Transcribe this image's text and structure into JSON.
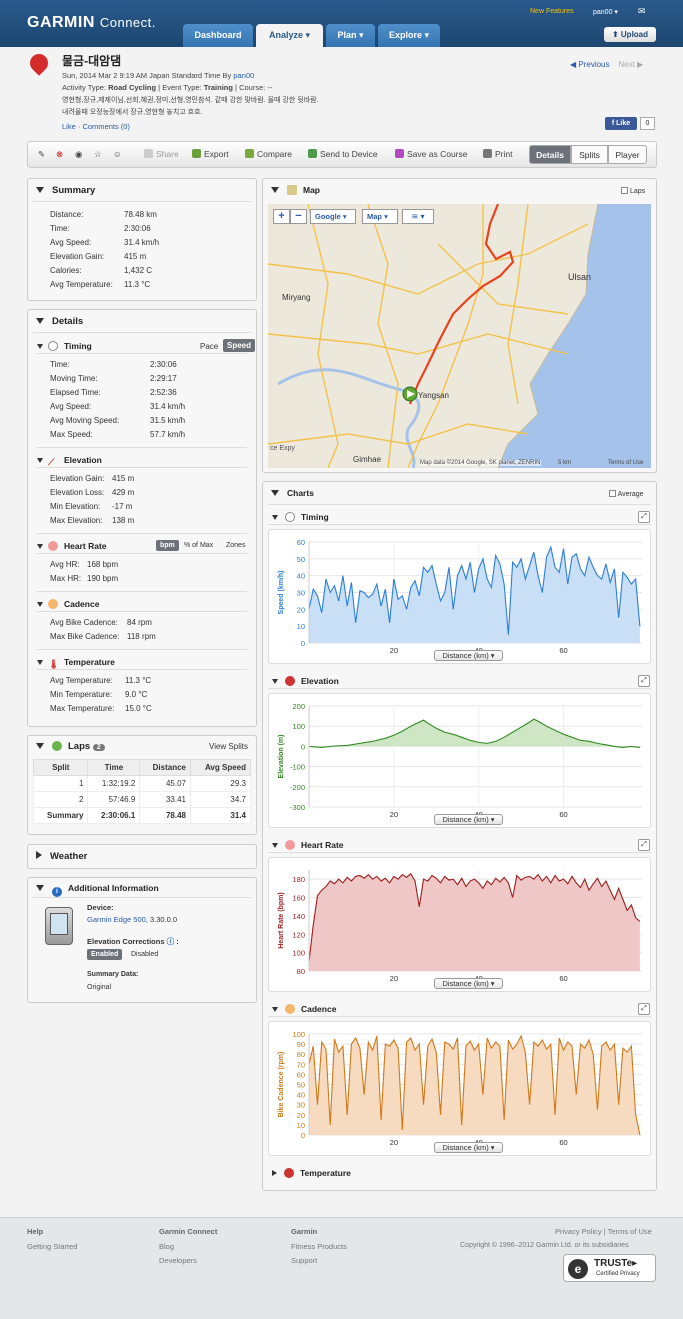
{
  "nav": {
    "logo": "GARMIN",
    "logo_sub": "Connect.",
    "tabs": [
      "Dashboard",
      "Analyze",
      "Plan",
      "Explore"
    ],
    "new_features": "New Features",
    "user": "pan00",
    "upload": "Upload"
  },
  "activity": {
    "name": "물금-대암댐",
    "date_line": "Sun, 2014 Mar 2 9:19 AM Japan Standard Time By",
    "author": "pan00",
    "type_label": "Activity Type:",
    "type": "Road Cycling",
    "event_label": "| Event Type:",
    "event": "Training",
    "course": "| Course: --",
    "desc1": "영현형,장규,제제이님,선회,혜권,정미,선형,영민참석. 같때 강한 맞바람. 올때 강한 뒷바람.",
    "desc2": "내려올때 오정능장에서 장규,영현형 놓치고 흐흐.",
    "like": "Like",
    "comments": "Comments (0)",
    "prev": "Previous",
    "next": "Next",
    "fb_like": "Like",
    "fb_count": "0"
  },
  "toolbar": {
    "share": "Share",
    "export": "Export",
    "compare": "Compare",
    "send": "Send to Device",
    "save": "Save as Course",
    "print": "Print",
    "views": [
      "Details",
      "Splits",
      "Player"
    ]
  },
  "summary": {
    "title": "Summary",
    "rows": [
      [
        "Distance:",
        "78.48 km"
      ],
      [
        "Time:",
        "2:30:06"
      ],
      [
        "Avg Speed:",
        "31.4 km/h"
      ],
      [
        "Elevation Gain:",
        "415 m"
      ],
      [
        "Calories:",
        "1,432 C"
      ],
      [
        "Avg Temperature:",
        "11.3 °C"
      ]
    ]
  },
  "details": {
    "title": "Details",
    "timing": {
      "title": "Timing",
      "pace": "Pace",
      "speed": "Speed",
      "rows": [
        [
          "Time:",
          "2:30:06"
        ],
        [
          "Moving Time:",
          "2:29:17"
        ],
        [
          "Elapsed Time:",
          "2:52:36"
        ],
        [
          "Avg Speed:",
          "31.4 km/h"
        ],
        [
          "Avg Moving Speed:",
          "31.5 km/h"
        ],
        [
          "Max Speed:",
          "57.7 km/h"
        ]
      ]
    },
    "elevation": {
      "title": "Elevation",
      "rows": [
        [
          "Elevation Gain:",
          "415 m"
        ],
        [
          "Elevation Loss:",
          "429 m"
        ],
        [
          "Min Elevation:",
          "-17 m"
        ],
        [
          "Max Elevation:",
          "138 m"
        ]
      ]
    },
    "heart": {
      "title": "Heart Rate",
      "bpm": "bpm",
      "pctmax": "% of Max",
      "zones": "Zones",
      "rows": [
        [
          "Avg HR:",
          "168 bpm"
        ],
        [
          "Max HR:",
          "190 bpm"
        ]
      ]
    },
    "cadence": {
      "title": "Cadence",
      "rows": [
        [
          "Avg Bike Cadence:",
          "84 rpm"
        ],
        [
          "Max Bike Cadence:",
          "118 rpm"
        ]
      ]
    },
    "temperature": {
      "title": "Temperature",
      "rows": [
        [
          "Avg Temperature:",
          "11.3 °C"
        ],
        [
          "Min Temperature:",
          "9.0 °C"
        ],
        [
          "Max Temperature:",
          "15.0 °C"
        ]
      ]
    }
  },
  "laps": {
    "title": "Laps",
    "count": "2",
    "view_splits": "View Splits",
    "headers": [
      "Split",
      "Time",
      "Distance",
      "Avg Speed"
    ],
    "rows": [
      [
        "1",
        "1:32:19.2",
        "45.07",
        "29.3"
      ],
      [
        "2",
        "57:46.9",
        "33.41",
        "34.7"
      ],
      [
        "Summary",
        "2:30:06.1",
        "78.48",
        "31.4"
      ]
    ]
  },
  "weather": {
    "title": "Weather"
  },
  "additional": {
    "title": "Additional Information",
    "device_label": "Device:",
    "device": "Garmin Edge 500",
    "device_ver": ", 3.30.0.0",
    "elev_corr": "Elevation Corrections",
    "enabled": "Enabled",
    "disabled": "Disabled",
    "summary_label": "Summary Data:",
    "summary_value": "Original"
  },
  "map": {
    "title": "Map",
    "laps": "Laps",
    "google": "Google",
    "mapbtn": "Map",
    "attribution": "Map data ©2014 Google, SK planet, ZENRIN",
    "scale": "5 km",
    "terms": "Terms of Use",
    "labels": [
      "Ulsan",
      "Miryang",
      "Yangsan",
      "Gimhae",
      "ce Expy"
    ],
    "route_color": "#e8431e"
  },
  "charts": {
    "title": "Charts",
    "average": "Average",
    "xlabel": "Distance (km)"
  },
  "chart_data": [
    {
      "type": "area",
      "title": "Timing",
      "ylabel": "Speed (km/h)",
      "ylim": [
        0,
        60
      ],
      "yticks": [
        0,
        10,
        20,
        30,
        40,
        50,
        60
      ],
      "xticks": [
        20,
        40,
        60
      ],
      "xlim": [
        0,
        78.5
      ],
      "color": "#2a7ed8",
      "fill": "#c9dff5",
      "x": [
        0,
        1,
        2,
        3,
        4,
        5,
        6,
        7,
        8,
        9,
        10,
        11,
        12,
        13,
        14,
        15,
        16,
        17,
        18,
        19,
        20,
        21,
        22,
        23,
        24,
        25,
        26,
        27,
        28,
        29,
        30,
        31,
        32,
        33,
        34,
        35,
        36,
        37,
        38,
        39,
        40,
        41,
        42,
        43,
        44,
        45,
        46,
        47,
        48,
        49,
        50,
        51,
        52,
        53,
        54,
        55,
        56,
        57,
        58,
        59,
        60,
        61,
        62,
        63,
        64,
        65,
        66,
        67,
        68,
        69,
        70,
        71,
        72,
        73,
        74,
        75,
        76,
        77,
        78
      ],
      "y": [
        20,
        32,
        28,
        18,
        38,
        30,
        34,
        25,
        40,
        22,
        36,
        12,
        31,
        30,
        27,
        29,
        35,
        22,
        32,
        12,
        38,
        26,
        28,
        20,
        33,
        37,
        28,
        45,
        42,
        46,
        35,
        25,
        30,
        45,
        20,
        40,
        46,
        38,
        48,
        30,
        44,
        50,
        38,
        33,
        52,
        47,
        35,
        5,
        48,
        45,
        50,
        38,
        46,
        54,
        40,
        30,
        51,
        57,
        45,
        42,
        56,
        35,
        51,
        53,
        44,
        40,
        51,
        45,
        40,
        38,
        47,
        36,
        44,
        15,
        42,
        39,
        35,
        38,
        10
      ]
    },
    {
      "type": "area",
      "title": "Elevation",
      "ylabel": "Elevation (m)",
      "ylim": [
        -300,
        200
      ],
      "yticks": [
        -300,
        -200,
        -100,
        0,
        100,
        200
      ],
      "xticks": [
        20,
        40,
        60
      ],
      "xlim": [
        0,
        78.5
      ],
      "color": "#2f8a1f",
      "fill": "#cfe6c5",
      "x": [
        0,
        3,
        6,
        9,
        12,
        15,
        18,
        20,
        22,
        24,
        26,
        27,
        28,
        30,
        32,
        34,
        36,
        38,
        40,
        42,
        44,
        46,
        48,
        50,
        52,
        53,
        54,
        56,
        58,
        60,
        62,
        64,
        66,
        68,
        70,
        72,
        74,
        76,
        78
      ],
      "y": [
        0,
        -5,
        2,
        5,
        15,
        25,
        40,
        55,
        75,
        100,
        120,
        130,
        115,
        90,
        70,
        60,
        45,
        30,
        20,
        15,
        25,
        45,
        70,
        95,
        120,
        135,
        125,
        100,
        80,
        60,
        45,
        30,
        25,
        15,
        8,
        0,
        -5,
        0,
        -5
      ]
    },
    {
      "type": "area",
      "title": "Heart Rate",
      "ylabel": "Heart Rate (bpm)",
      "ylim": [
        80,
        190
      ],
      "yticks": [
        80,
        100,
        120,
        140,
        160,
        180
      ],
      "xticks": [
        20,
        40,
        60
      ],
      "xlim": [
        0,
        78.5
      ],
      "color": "#9e1c1c",
      "fill": "#efc7c7",
      "x": [
        0,
        1,
        2,
        3,
        4,
        5,
        6,
        7,
        8,
        9,
        10,
        11,
        12,
        13,
        14,
        15,
        16,
        17,
        18,
        19,
        20,
        21,
        22,
        23,
        24,
        25,
        26,
        27,
        28,
        29,
        30,
        31,
        32,
        33,
        34,
        35,
        36,
        37,
        38,
        39,
        40,
        41,
        42,
        43,
        44,
        45,
        46,
        47,
        48,
        49,
        50,
        51,
        52,
        53,
        54,
        55,
        56,
        57,
        58,
        59,
        60,
        61,
        62,
        63,
        64,
        65,
        66,
        67,
        68,
        69,
        70,
        71,
        72,
        73,
        74,
        75,
        76,
        77,
        78
      ],
      "y": [
        90,
        130,
        162,
        168,
        172,
        178,
        175,
        180,
        176,
        182,
        178,
        183,
        184,
        181,
        185,
        180,
        183,
        178,
        181,
        176,
        183,
        180,
        185,
        182,
        186,
        178,
        150,
        180,
        178,
        184,
        181,
        176,
        183,
        179,
        180,
        174,
        181,
        172,
        178,
        180,
        176,
        170,
        178,
        174,
        181,
        177,
        182,
        176,
        160,
        184,
        179,
        182,
        183,
        180,
        185,
        178,
        183,
        176,
        184,
        178,
        180,
        175,
        183,
        176,
        171,
        180,
        168,
        175,
        181,
        172,
        178,
        168,
        158,
        170,
        158,
        146,
        152,
        138,
        134
      ]
    },
    {
      "type": "area",
      "title": "Cadence",
      "ylabel": "Bike Cadence (rpm)",
      "ylim": [
        0,
        100
      ],
      "yticks": [
        0,
        10,
        20,
        30,
        40,
        50,
        60,
        70,
        80,
        90,
        100
      ],
      "xticks": [
        20,
        40,
        60
      ],
      "xlim": [
        0,
        78.5
      ],
      "color": "#d07818",
      "fill": "#f6dbc0",
      "x": [
        0,
        1,
        2,
        3,
        4,
        5,
        6,
        7,
        8,
        9,
        10,
        11,
        12,
        13,
        14,
        15,
        16,
        17,
        18,
        19,
        20,
        21,
        22,
        23,
        24,
        25,
        26,
        27,
        28,
        29,
        30,
        31,
        32,
        33,
        34,
        35,
        36,
        37,
        38,
        39,
        40,
        41,
        42,
        43,
        44,
        45,
        46,
        47,
        48,
        49,
        50,
        51,
        52,
        53,
        54,
        55,
        56,
        57,
        58,
        59,
        60,
        61,
        62,
        63,
        64,
        65,
        66,
        67,
        68,
        69,
        70,
        71,
        72,
        73,
        74,
        75,
        76,
        77,
        78
      ],
      "y": [
        70,
        88,
        30,
        92,
        85,
        10,
        95,
        82,
        88,
        20,
        90,
        96,
        86,
        40,
        92,
        84,
        98,
        15,
        90,
        88,
        94,
        86,
        5,
        92,
        96,
        84,
        90,
        30,
        88,
        95,
        82,
        20,
        92,
        90,
        85,
        96,
        10,
        88,
        93,
        84,
        90,
        40,
        96,
        86,
        92,
        88,
        15,
        94,
        85,
        90,
        98,
        82,
        30,
        92,
        88,
        94,
        85,
        90,
        20,
        96,
        84,
        92,
        88,
        40,
        90,
        86,
        94,
        80,
        25,
        88,
        92,
        84,
        90,
        30,
        86,
        82,
        88,
        20,
        0
      ]
    },
    {
      "type": "area",
      "title": "Temperature"
    }
  ],
  "footer": {
    "help": "Help",
    "getting_started": "Getting Started",
    "gc": "Garmin Connect",
    "blog": "Blog",
    "developers": "Developers",
    "garmin": "Garmin",
    "fitness": "Fitness Products",
    "support": "Support",
    "privacy": "Privacy Policy | Terms of Use",
    "copyright": "Copyright © 1996–2012 Garmin Ltd. or its subsidiaries",
    "truste": "TRUSTe",
    "truste_sub": "Certified Privacy"
  }
}
